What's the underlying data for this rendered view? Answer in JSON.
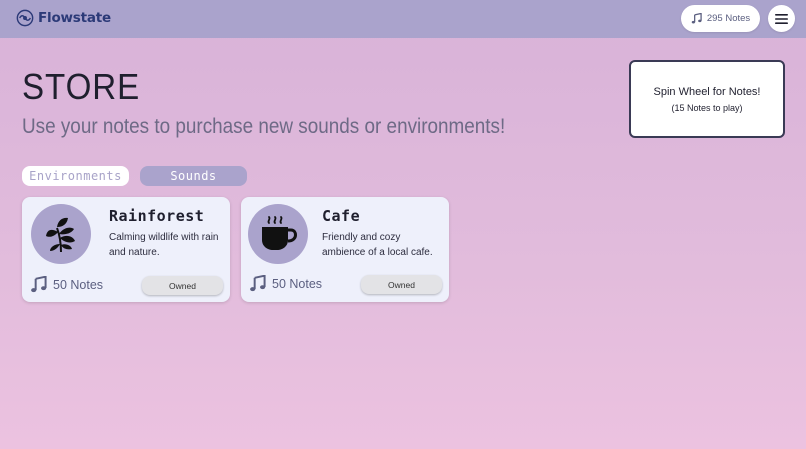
{
  "app": {
    "name": "Flowstate"
  },
  "header": {
    "notes_count": "295 Notes",
    "menu_icon": "hamburger-menu-icon"
  },
  "page": {
    "title": "STORE",
    "subtitle": "Use your notes to purchase new sounds or environments!"
  },
  "spin": {
    "title": "Spin Wheel for Notes!",
    "cost": "(15 Notes to play)"
  },
  "tabs": [
    {
      "label": "Environments",
      "active": true
    },
    {
      "label": "Sounds",
      "active": false
    }
  ],
  "items": [
    {
      "name": "Rainforest",
      "description": "Calming wildlife with rain and nature.",
      "price": "50 Notes",
      "status": "Owned",
      "icon": "leaf-branch-icon"
    },
    {
      "name": "Cafe",
      "description": "Friendly and cozy ambience of a local cafe.",
      "price": "50 Notes",
      "status": "Owned",
      "icon": "coffee-cup-icon"
    }
  ],
  "colors": {
    "topbar": "#aaa3cc",
    "accent": "#aaa3cc",
    "logo_text": "#2c3a78",
    "card_bg": "#eef0fb"
  }
}
